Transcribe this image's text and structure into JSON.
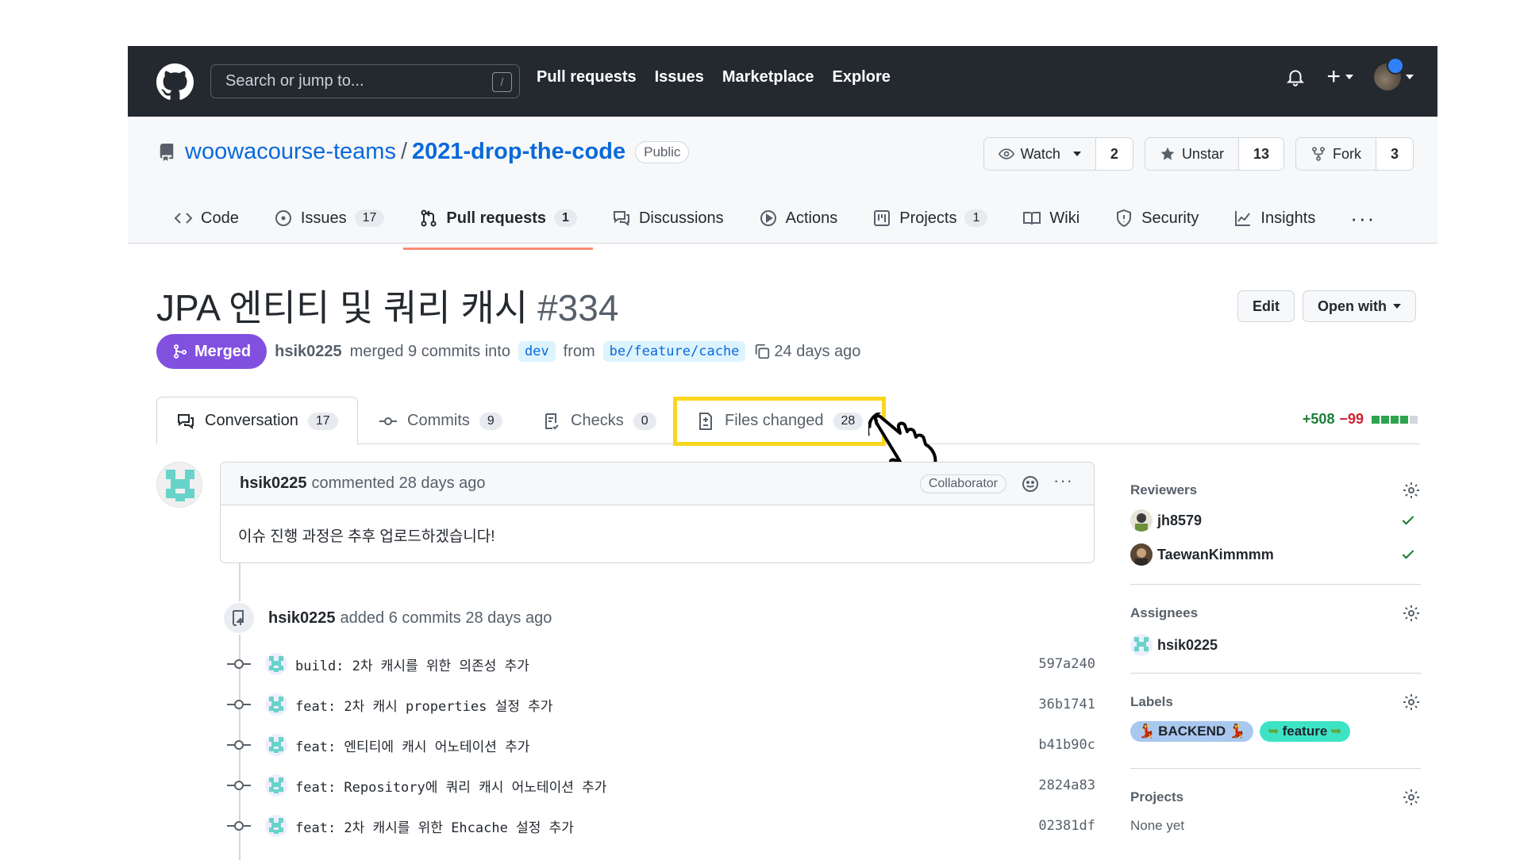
{
  "topbar": {
    "search_placeholder": "Search or jump to...",
    "search_shortcut": "/",
    "nav": [
      "Pull requests",
      "Issues",
      "Marketplace",
      "Explore"
    ]
  },
  "repo": {
    "owner": "woowacourse-teams",
    "separator": "/",
    "name": "2021-drop-the-code",
    "visibility": "Public",
    "watch_label": "Watch",
    "watch_count": "2",
    "star_label": "Unstar",
    "star_count": "13",
    "fork_label": "Fork",
    "fork_count": "3",
    "tabs": [
      {
        "label": "Code",
        "icon": "code-icon",
        "count": ""
      },
      {
        "label": "Issues",
        "icon": "issue-icon",
        "count": "17"
      },
      {
        "label": "Pull requests",
        "icon": "pull-request-icon",
        "count": "1"
      },
      {
        "label": "Discussions",
        "icon": "discussions-icon",
        "count": ""
      },
      {
        "label": "Actions",
        "icon": "play-icon",
        "count": ""
      },
      {
        "label": "Projects",
        "icon": "project-icon",
        "count": "1"
      },
      {
        "label": "Wiki",
        "icon": "book-icon",
        "count": ""
      },
      {
        "label": "Security",
        "icon": "shield-icon",
        "count": ""
      },
      {
        "label": "Insights",
        "icon": "graph-icon",
        "count": ""
      }
    ],
    "more": "···"
  },
  "pr": {
    "title": "JPA 엔티티 및 쿼리 캐시",
    "number": "#334",
    "edit_label": "Edit",
    "open_with_label": "Open with",
    "state": "Merged",
    "author": "hsik0225",
    "merged_text": "merged 9 commits into",
    "base_branch": "dev",
    "from_text": "from",
    "head_branch": "be/feature/cache",
    "time": "24 days ago"
  },
  "pr_tabs": [
    {
      "label": "Conversation",
      "count": "17"
    },
    {
      "label": "Commits",
      "count": "9"
    },
    {
      "label": "Checks",
      "count": "0"
    },
    {
      "label": "Files changed",
      "count": "28"
    }
  ],
  "diffstat": {
    "additions": "+508",
    "deletions": "−99"
  },
  "comment": {
    "author": "hsik0225",
    "action": "commented 28 days ago",
    "role": "Collaborator",
    "body": "이슈 진행 과정은 추후 업로드하겠습니다!"
  },
  "timeline_event": {
    "author": "hsik0225",
    "text": "added 6 commits 28 days ago"
  },
  "commits": [
    {
      "message": "build: 2차 캐시를 위한 의존성 추가",
      "sha": "597a240"
    },
    {
      "message": "feat: 2차 캐시 properties 설정 추가",
      "sha": "36b1741"
    },
    {
      "message": "feat: 엔티티에 캐시 어노테이션 추가",
      "sha": "b41b90c"
    },
    {
      "message": "feat: Repository에 쿼리 캐시 어노테이션 추가",
      "sha": "2824a83"
    },
    {
      "message": "feat: 2차 캐시를 위한 Ehcache 설정 추가",
      "sha": "02381df"
    }
  ],
  "sidebar": {
    "reviewers_title": "Reviewers",
    "reviewers": [
      "jh8579",
      "TaewanKimmmm"
    ],
    "assignees_title": "Assignees",
    "assignees": [
      "hsik0225"
    ],
    "labels_title": "Labels",
    "labels": [
      {
        "name": "BACKEND",
        "color": "#a9c8f0"
      },
      {
        "name": "feature",
        "color": "#3ee3c6"
      }
    ],
    "projects_title": "Projects",
    "projects_value": "None yet"
  },
  "colors": {
    "merged": "#8250df",
    "highlight": "#f9d71c",
    "link": "#0969da",
    "additions": "#1a7f37",
    "deletions": "#cf222e"
  }
}
